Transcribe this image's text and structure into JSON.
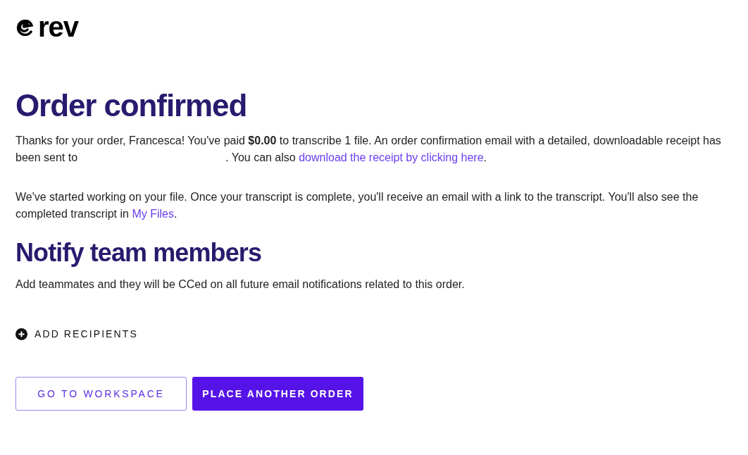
{
  "logo": {
    "text": "rev"
  },
  "title": "Order confirmed",
  "confirmation": {
    "before": "Thanks for your order, Francesca!  You've paid **$0.00** to transcribe 1 file. An order confirmation email with a detailed, downloadable receipt has been sent to",
    "middle": ". You can also",
    "link": "download the receipt by clicking here",
    "after": "."
  },
  "progress": {
    "before": "We've started working on your file. Once your transcript is complete, you'll receive an email with a link to the transcript. You'll also see the completed transcript in",
    "link": "My Files",
    "after": "."
  },
  "notify": {
    "heading": "Notify team members",
    "description": "Add teammates and they will be CCed on all future email notifications related to this order.",
    "add_label": "ADD RECIPIENTS"
  },
  "buttons": [
    {
      "label": "GO TO WORKSPACE",
      "kind": "outline"
    },
    {
      "label": "PLACE ANOTHER ORDER",
      "kind": "primary"
    }
  ]
}
